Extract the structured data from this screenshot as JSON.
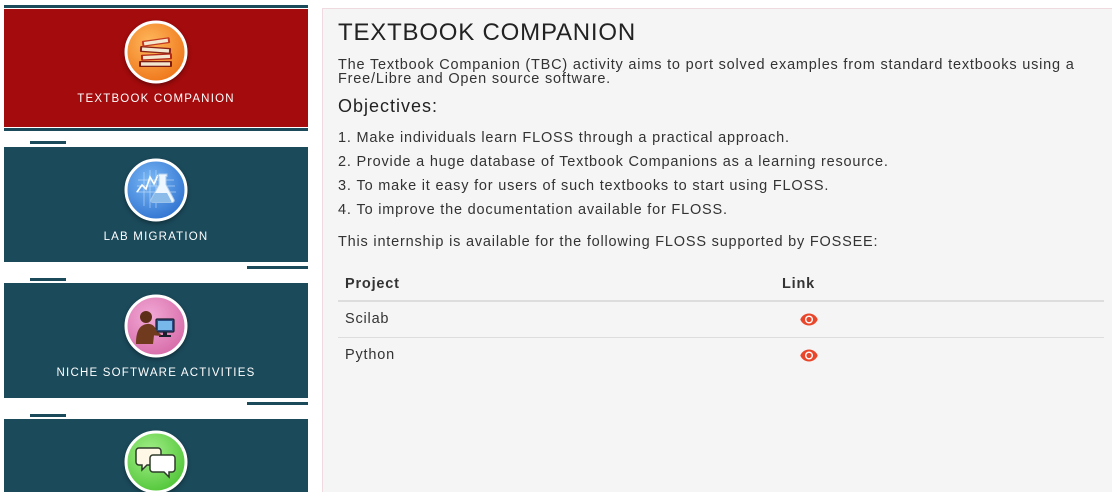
{
  "sidebar": {
    "tiles": [
      {
        "label": "TEXTBOOK COMPANION",
        "icon": "books-icon",
        "color": "#a30b0c",
        "active": true
      },
      {
        "label": "LAB MIGRATION",
        "icon": "flask-chart-icon",
        "color": "#1b4a5b",
        "active": false
      },
      {
        "label": "NICHE SOFTWARE ACTIVITIES",
        "icon": "person-computer-icon",
        "color": "#1b4a5b",
        "active": false
      },
      {
        "icon": "speech-bubbles-icon",
        "color": "#1b4a5b",
        "active": false
      }
    ],
    "divider_color": "#1b4a5b"
  },
  "main": {
    "title": "TEXTBOOK COMPANION",
    "intro": "The Textbook Companion (TBC) activity aims to port solved examples from standard textbooks using a Free/Libre and Open source software.",
    "objectives_heading": "Objectives:",
    "objectives": [
      "Make individuals learn FLOSS through a practical approach.",
      "Provide a huge database of Textbook Companions as a learning resource.",
      "To make it easy for users of such textbooks to start using FLOSS.",
      "To improve the documentation available for FLOSS."
    ],
    "availability_text": "This internship is available for the following FLOSS supported by FOSSEE:",
    "table": {
      "headers": {
        "project": "Project",
        "link": "Link"
      },
      "rows": [
        {
          "project": "Scilab",
          "link_icon": "eye-icon"
        },
        {
          "project": "Python",
          "link_icon": "eye-icon"
        }
      ]
    }
  },
  "colors": {
    "panel_background": "#f5f5f5",
    "link_icon": "#e9472b"
  }
}
